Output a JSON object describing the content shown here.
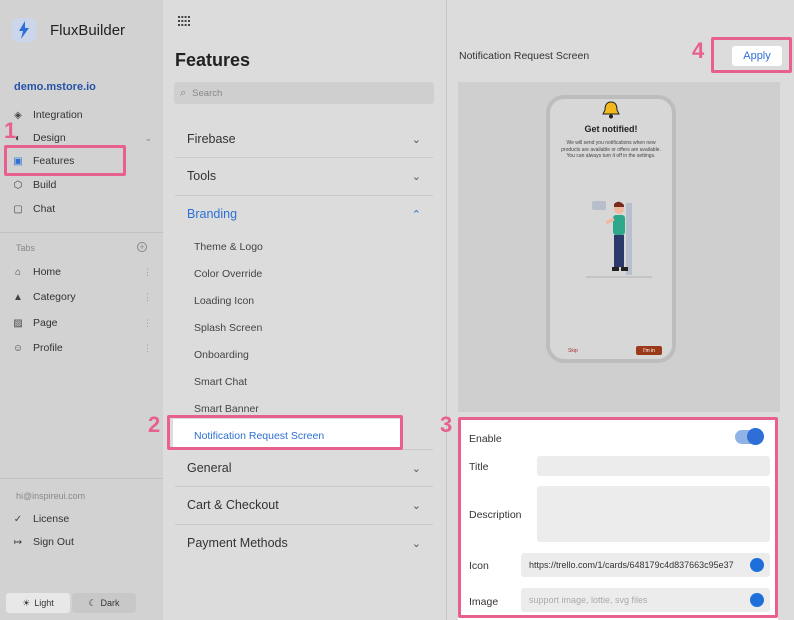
{
  "app": {
    "brand": "FluxBuilder",
    "domain": "demo.mstore.io",
    "accent": "#2d6fd6",
    "highlight": "#e8608e"
  },
  "sidebar": {
    "items": [
      {
        "label": "Integration",
        "icon": "layers-icon"
      },
      {
        "label": "Design",
        "icon": "palette-icon"
      },
      {
        "label": "Features",
        "icon": "box-icon"
      },
      {
        "label": "Build",
        "icon": "cube-icon"
      },
      {
        "label": "Chat",
        "icon": "chat-icon"
      }
    ],
    "tabs_header": "Tabs",
    "tabs": [
      {
        "label": "Home",
        "icon": "home-icon"
      },
      {
        "label": "Category",
        "icon": "triangle-icon"
      },
      {
        "label": "Page",
        "icon": "image-icon"
      },
      {
        "label": "Profile",
        "icon": "person-icon"
      }
    ],
    "email": "hi@inspireui.com",
    "bottom": [
      {
        "label": "License",
        "icon": "check-circle-icon"
      },
      {
        "label": "Sign Out",
        "icon": "logout-icon"
      }
    ],
    "theme": {
      "light": "Light",
      "dark": "Dark"
    }
  },
  "features": {
    "title": "Features",
    "search_placeholder": "Search",
    "sections": [
      "Firebase",
      "Tools",
      "Branding",
      "General",
      "Cart & Checkout",
      "Payment Methods"
    ],
    "branding_items": [
      "Theme & Logo",
      "Color Override",
      "Loading Icon",
      "Splash Screen",
      "Onboarding",
      "Smart Chat",
      "Smart Banner",
      "Notification Request Screen"
    ]
  },
  "preview": {
    "title": "Notification Request Screen",
    "apply_label": "Apply",
    "phone": {
      "heading": "Get notified!",
      "description": "We will send you notifications when new products are available or offers are available. You can always turn it off in the settings.",
      "skip": "Skip",
      "confirm": "I'm in"
    }
  },
  "settings": {
    "enable_label": "Enable",
    "enabled": true,
    "title_label": "Title",
    "description_label": "Description",
    "icon_label": "Icon",
    "icon_value": "https://trello.com/1/cards/648179c4d837663c95e37",
    "image_label": "Image",
    "image_placeholder": "support image, lottie, svg files"
  },
  "callouts": [
    "1",
    "2",
    "3",
    "4"
  ]
}
